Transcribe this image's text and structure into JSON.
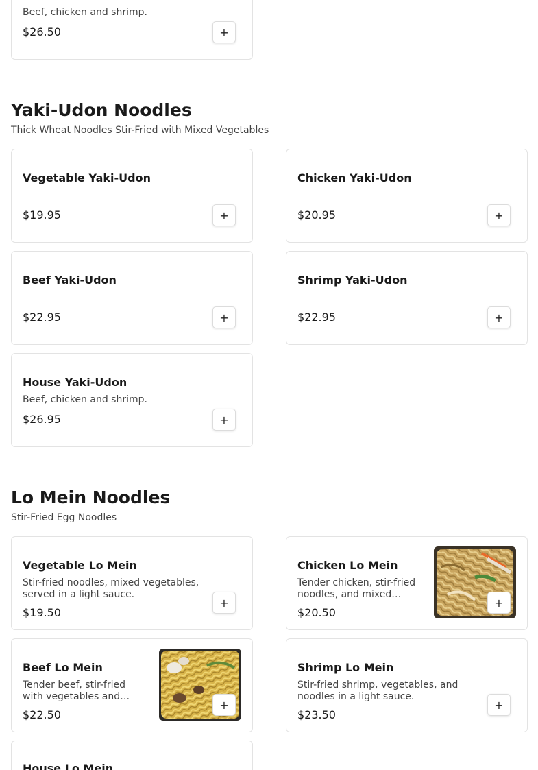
{
  "sections": [
    {
      "items": [
        {
          "name": "",
          "description": "Beef, chicken and shrimp.",
          "price": "$26.50",
          "add_label": "+"
        }
      ]
    },
    {
      "title": "Yaki-Udon Noodles",
      "subtitle": "Thick Wheat Noodles Stir-Fried with Mixed Vegetables",
      "items": [
        {
          "name": "Vegetable Yaki-Udon",
          "description": "",
          "price": "$19.95",
          "add_label": "+"
        },
        {
          "name": "Chicken Yaki-Udon",
          "description": "",
          "price": "$20.95",
          "add_label": "+"
        },
        {
          "name": "Beef Yaki-Udon",
          "description": "",
          "price": "$22.95",
          "add_label": "+"
        },
        {
          "name": "Shrimp Yaki-Udon",
          "description": "",
          "price": "$22.95",
          "add_label": "+"
        },
        {
          "name": "House Yaki-Udon",
          "description": "Beef, chicken and shrimp.",
          "price": "$26.95",
          "add_label": "+"
        }
      ]
    },
    {
      "title": "Lo Mein Noodles",
      "subtitle": "Stir-Fried Egg Noodles",
      "items": [
        {
          "name": "Vegetable Lo Mein",
          "description": "Stir-fried noodles, mixed vegetables, served in a light sauce.",
          "price": "$19.50",
          "add_label": "+"
        },
        {
          "name": "Chicken Lo Mein",
          "description": "Tender chicken, stir-fried noodles, and mixed…",
          "price": "$20.50",
          "add_label": "+",
          "has_image": true
        },
        {
          "name": "Beef Lo Mein",
          "description": "Tender beef, stir-fried with vegetables and…",
          "price": "$22.50",
          "add_label": "+",
          "has_image": true
        },
        {
          "name": "Shrimp Lo Mein",
          "description": "Stir-fried shrimp, vegetables, and noodles in a light sauce.",
          "price": "$23.50",
          "add_label": "+"
        },
        {
          "name": "House Lo Mein",
          "description": "",
          "price": "",
          "add_label": ""
        }
      ]
    }
  ],
  "icons": {
    "add": "plus-icon",
    "food_photo": "noodle-dish-photo"
  }
}
